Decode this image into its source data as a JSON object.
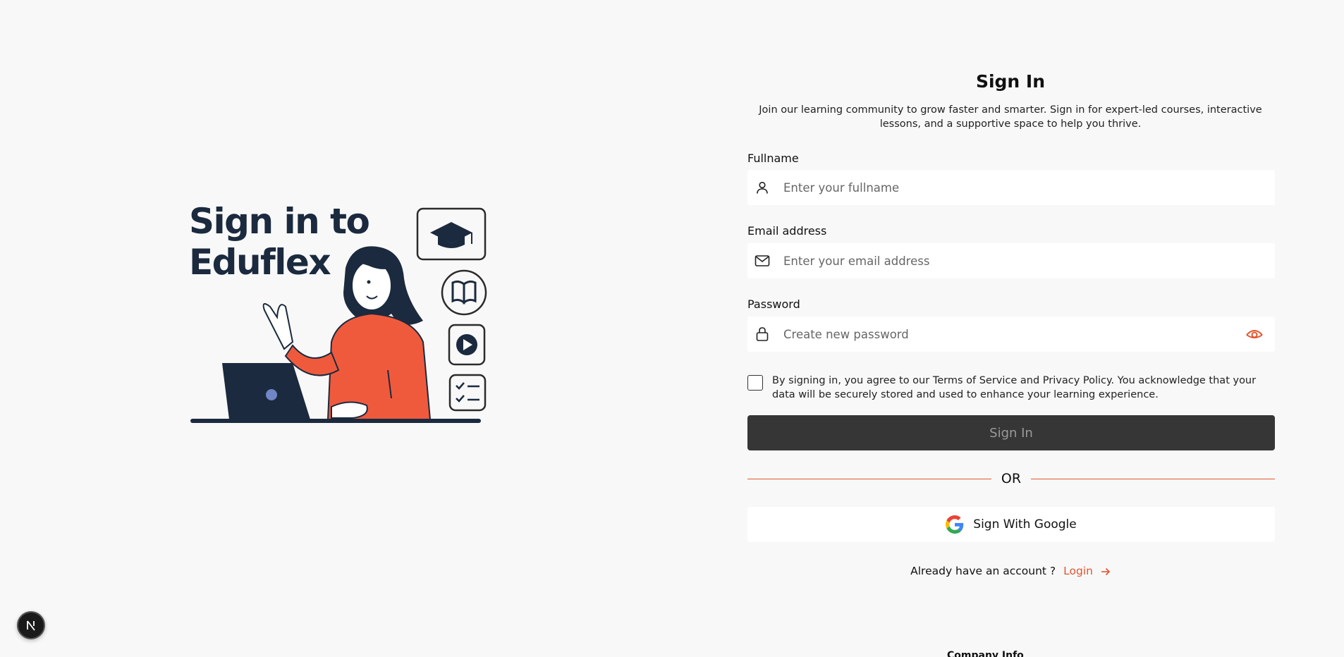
{
  "illustration": {
    "title_line1": "Sign in to",
    "title_line2": "Eduflex"
  },
  "form": {
    "title": "Sign In",
    "subtitle": "Join our learning community to grow faster and smarter. Sign in for expert-led courses, interactive lessons, and a supportive space to help you thrive.",
    "fullname": {
      "label": "Fullname",
      "placeholder": "Enter your fullname",
      "value": ""
    },
    "email": {
      "label": "Email address",
      "placeholder": "Enter your email address",
      "value": ""
    },
    "password": {
      "label": "Password",
      "placeholder": "Create new password",
      "value": ""
    },
    "terms_text": "By signing in, you agree to our Terms of Service and Privacy Policy. You acknowledge that your data will be securely stored and used to enhance your learning experience.",
    "terms_checked": false,
    "signin_label": "Sign In",
    "or_label": "OR",
    "google_label": "Sign With Google",
    "already_text": "Already have an account ?",
    "login_label": "Login"
  },
  "footer": {
    "peek_text": "Company Info"
  },
  "colors": {
    "accent": "#e3552e",
    "button_dark": "#363636",
    "background": "#f8f8f8"
  },
  "icons": [
    "user-icon",
    "mail-icon",
    "lock-icon",
    "eye-icon",
    "google-icon",
    "arrow-right-icon",
    "nextjs-icon"
  ]
}
